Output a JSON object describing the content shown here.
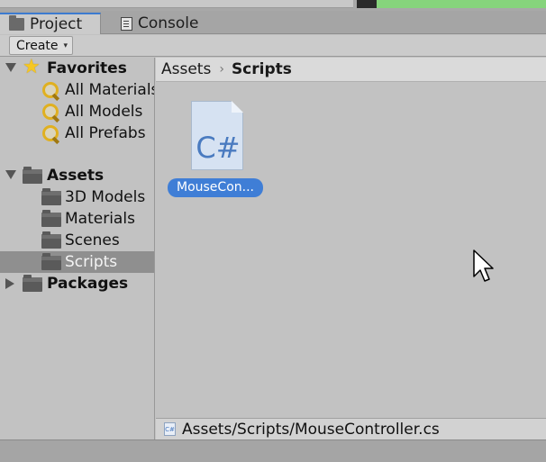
{
  "tabs": [
    {
      "label": "Project",
      "icon": "folder-icon",
      "active": true
    },
    {
      "label": "Console",
      "icon": "console-icon",
      "active": false
    }
  ],
  "toolbar": {
    "create_label": "Create",
    "create_caret": "▾"
  },
  "tree": {
    "favorites": {
      "label": "Favorites",
      "icon": "star-icon",
      "items": [
        {
          "label": "All Materials",
          "icon": "search-icon"
        },
        {
          "label": "All Models",
          "icon": "search-icon"
        },
        {
          "label": "All Prefabs",
          "icon": "search-icon"
        }
      ]
    },
    "assets": {
      "label": "Assets",
      "icon": "folder-icon",
      "items": [
        {
          "label": "3D Models",
          "selected": false
        },
        {
          "label": "Materials",
          "selected": false
        },
        {
          "label": "Scenes",
          "selected": false
        },
        {
          "label": "Scripts",
          "selected": true
        }
      ]
    },
    "packages": {
      "label": "Packages",
      "icon": "folder-icon"
    }
  },
  "breadcrumb": {
    "root": "Assets",
    "separator": "›",
    "current": "Scripts"
  },
  "assets_grid": [
    {
      "name": "MouseCon...",
      "type_glyph": "C#",
      "icon": "csharp-script-icon",
      "selected": true
    }
  ],
  "status_path": {
    "path": "Assets/Scripts/MouseController.cs",
    "icon_text": "C#"
  },
  "colors": {
    "selection_blue": "#3f7ed6",
    "tab_accent": "#3c7bd0",
    "tree_selected": "#8f8f8f"
  }
}
